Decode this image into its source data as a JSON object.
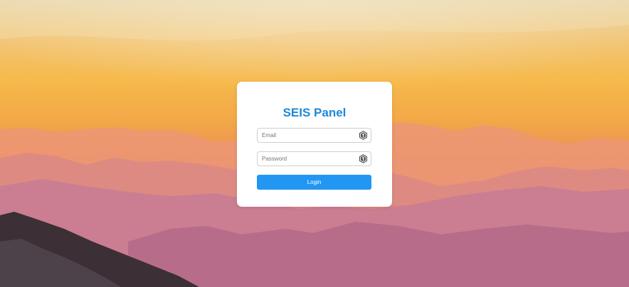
{
  "login": {
    "title": "SEIS Panel",
    "email": {
      "placeholder": "Email",
      "value": "",
      "icon": "key-icon"
    },
    "password": {
      "placeholder": "Password",
      "value": "",
      "icon": "key-icon"
    },
    "submit_label": "Login"
  },
  "colors": {
    "title": "#1e88d8",
    "button": "#2196f3",
    "card": "#ffffff"
  }
}
